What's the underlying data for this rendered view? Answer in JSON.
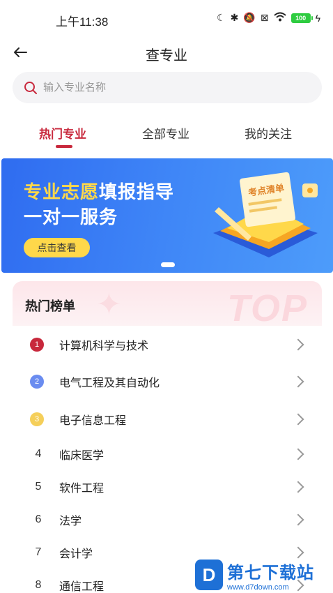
{
  "status": {
    "time": "上午11:38",
    "battery": "100"
  },
  "nav": {
    "title": "查专业"
  },
  "search": {
    "placeholder": "输入专业名称"
  },
  "tabs": [
    {
      "label": "热门专业",
      "active": true
    },
    {
      "label": "全部专业",
      "active": false
    },
    {
      "label": "我的关注",
      "active": false
    }
  ],
  "banner": {
    "line1_highlight": "专业志愿",
    "line1_rest": "填报指导",
    "line2": "一对一服务",
    "button": "点击查看",
    "illustration_tag": "考点清单"
  },
  "hot_list": {
    "title": "热门榜单",
    "watermark": "TOP",
    "items": [
      {
        "rank": "1",
        "name": "计算机科学与技术",
        "medal_color": "#c8283c"
      },
      {
        "rank": "2",
        "name": "电气工程及其自动化",
        "medal_color": "#6a8cf0"
      },
      {
        "rank": "3",
        "name": "电子信息工程",
        "medal_color": "#f5cf5a"
      },
      {
        "rank": "4",
        "name": "临床医学"
      },
      {
        "rank": "5",
        "name": "软件工程"
      },
      {
        "rank": "6",
        "name": "法学"
      },
      {
        "rank": "7",
        "name": "会计学"
      },
      {
        "rank": "8",
        "name": "通信工程"
      }
    ]
  },
  "site_watermark": {
    "name": "第七下载站",
    "url": "www.d7down.com"
  },
  "colors": {
    "accent": "#c8283c",
    "banner_blue": "#3f86f7",
    "banner_yellow": "#ffd84a"
  }
}
